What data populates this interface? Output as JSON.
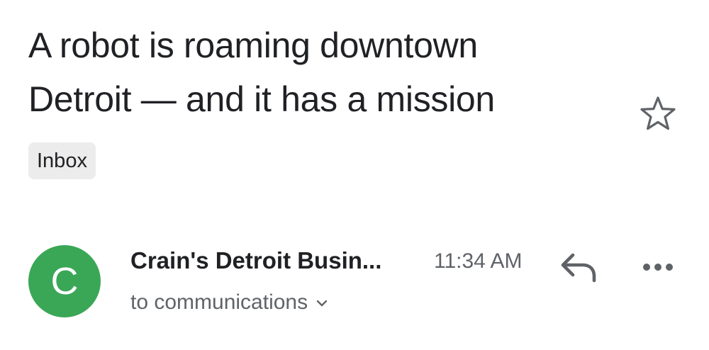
{
  "email": {
    "subject_line1": "A robot is roaming downtown",
    "subject_line2": "Detroit — and it has a mission",
    "label": "Inbox",
    "starred": false,
    "sender": {
      "initial": "C",
      "name": "Crain's Detroit Busin...",
      "avatar_color": "#3aa757"
    },
    "time": "11:34 AM",
    "recipient_text": "to communications"
  },
  "icons": {
    "star": "star-outline-icon",
    "reply": "reply-icon",
    "more": "more-horizontal-icon",
    "expand": "chevron-down-icon"
  }
}
